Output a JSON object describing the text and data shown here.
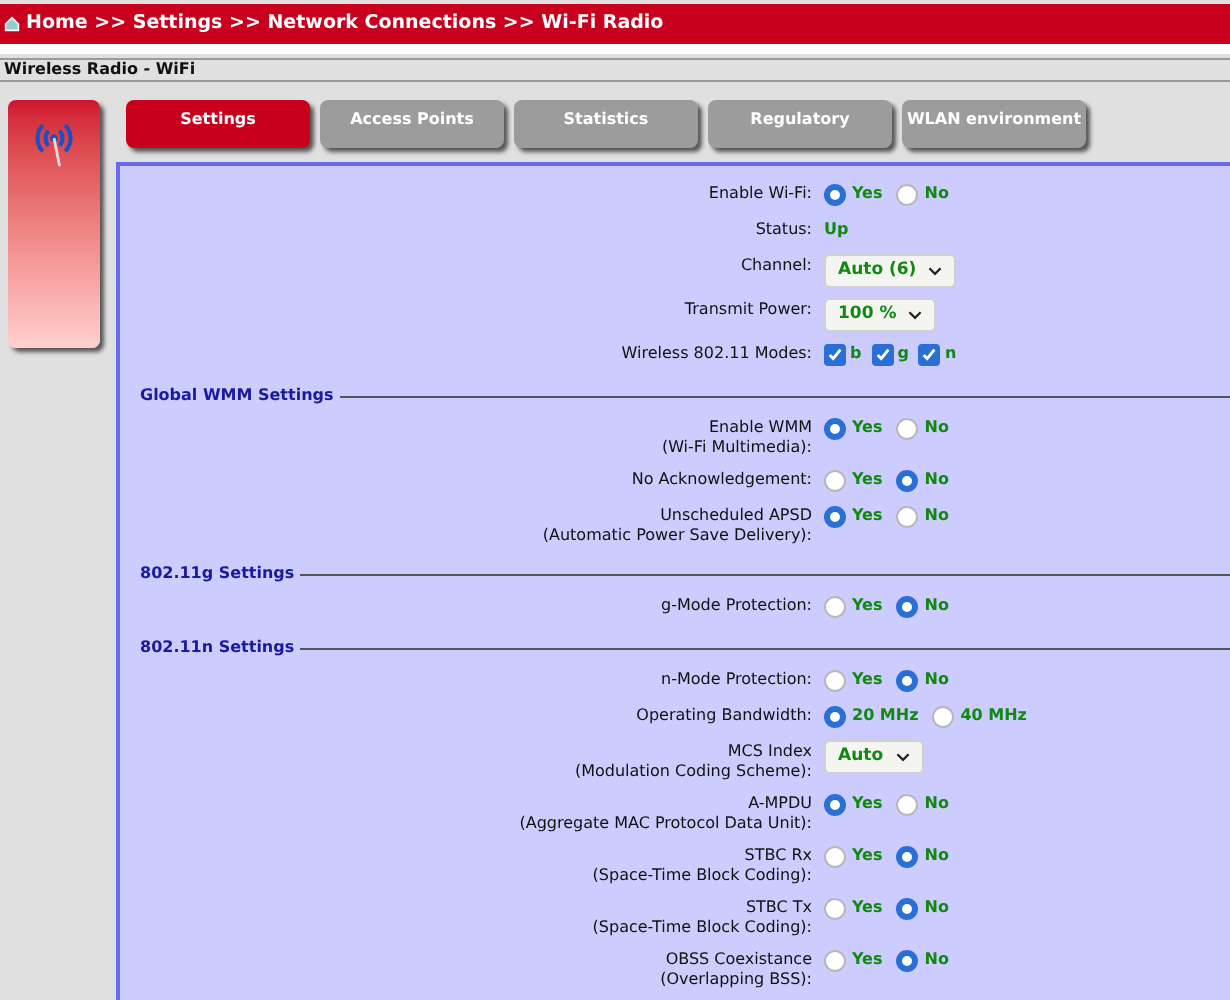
{
  "breadcrumb": "Home >> Settings >> Network Connections >> Wi-Fi Radio",
  "page_title": "Wireless Radio - WiFi",
  "tabs": [
    {
      "label": "Settings",
      "selected": true
    },
    {
      "label": "Access Points",
      "selected": false
    },
    {
      "label": "Statistics",
      "selected": false
    },
    {
      "label": "Regulatory",
      "selected": false
    },
    {
      "label": "WLAN environment",
      "selected": false
    }
  ],
  "sections": [
    {
      "rows": [
        {
          "kind": "radio",
          "label": "Enable Wi-Fi:",
          "options": [
            {
              "label": "Yes",
              "selected": true
            },
            {
              "label": "No",
              "selected": false
            }
          ]
        },
        {
          "kind": "text",
          "label": "Status:",
          "value": "Up"
        },
        {
          "kind": "select",
          "label": "Channel:",
          "value": "Auto (6)"
        },
        {
          "kind": "select",
          "label": "Transmit Power:",
          "value": "100 %"
        },
        {
          "kind": "checkboxes",
          "label": "Wireless 802.11 Modes:",
          "options": [
            {
              "label": "b",
              "checked": true
            },
            {
              "label": "g",
              "checked": true
            },
            {
              "label": "n",
              "checked": true
            }
          ]
        }
      ]
    },
    {
      "title": "Global WMM Settings",
      "rows": [
        {
          "kind": "radio",
          "label": "Enable WMM",
          "sublabel": "(Wi-Fi Multimedia):",
          "options": [
            {
              "label": "Yes",
              "selected": true
            },
            {
              "label": "No",
              "selected": false
            }
          ]
        },
        {
          "kind": "radio",
          "label": "No Acknowledgement:",
          "options": [
            {
              "label": "Yes",
              "selected": false
            },
            {
              "label": "No",
              "selected": true
            }
          ]
        },
        {
          "kind": "radio",
          "label": "Unscheduled APSD",
          "sublabel": "(Automatic Power Save Delivery):",
          "options": [
            {
              "label": "Yes",
              "selected": true
            },
            {
              "label": "No",
              "selected": false
            }
          ]
        }
      ]
    },
    {
      "title": "802.11g Settings",
      "rows": [
        {
          "kind": "radio",
          "label": "g-Mode Protection:",
          "options": [
            {
              "label": "Yes",
              "selected": false
            },
            {
              "label": "No",
              "selected": true
            }
          ]
        }
      ]
    },
    {
      "title": "802.11n Settings",
      "rows": [
        {
          "kind": "radio",
          "label": "n-Mode Protection:",
          "options": [
            {
              "label": "Yes",
              "selected": false
            },
            {
              "label": "No",
              "selected": true
            }
          ]
        },
        {
          "kind": "radio",
          "label": "Operating Bandwidth:",
          "options": [
            {
              "label": "20 MHz",
              "selected": true
            },
            {
              "label": "40 MHz",
              "selected": false
            }
          ]
        },
        {
          "kind": "select",
          "label": "MCS Index",
          "sublabel": "(Modulation Coding Scheme):",
          "value": "Auto"
        },
        {
          "kind": "radio",
          "label": "A-MPDU",
          "sublabel": "(Aggregate MAC Protocol Data Unit):",
          "options": [
            {
              "label": "Yes",
              "selected": true
            },
            {
              "label": "No",
              "selected": false
            }
          ]
        },
        {
          "kind": "radio",
          "label": "STBC Rx",
          "sublabel": "(Space-Time Block Coding):",
          "options": [
            {
              "label": "Yes",
              "selected": false
            },
            {
              "label": "No",
              "selected": true
            }
          ]
        },
        {
          "kind": "radio",
          "label": "STBC Tx",
          "sublabel": "(Space-Time Block Coding):",
          "options": [
            {
              "label": "Yes",
              "selected": false
            },
            {
              "label": "No",
              "selected": true
            }
          ]
        },
        {
          "kind": "radio",
          "label": "OBSS Coexistance",
          "sublabel": "(Overlapping BSS):",
          "options": [
            {
              "label": "Yes",
              "selected": false
            },
            {
              "label": "No",
              "selected": true
            }
          ]
        }
      ]
    }
  ]
}
